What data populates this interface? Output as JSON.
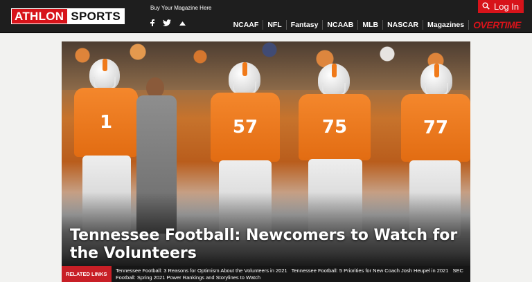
{
  "header": {
    "logo_left": "ATHLON",
    "logo_right": "SPORTS",
    "buy_magazine": "Buy Your Magazine Here",
    "social_icons": [
      "facebook-icon",
      "twitter-icon",
      "chevron-up-icon"
    ],
    "login_label": "Log In",
    "nav": [
      "NCAAF",
      "NFL",
      "Fantasy",
      "NCAAB",
      "MLB",
      "NASCAR",
      "Magazines"
    ],
    "overtime": "OVERTIME"
  },
  "hero": {
    "headline": "Tennessee Football: Newcomers to Watch for the Volunteers",
    "jersey_numbers": [
      "1",
      "57",
      "75",
      "77"
    ]
  },
  "related": {
    "label": "RELATED LINKS",
    "links": [
      "Tennessee Football: 3 Reasons for Optimism About the Volunteers in 2021",
      "Tennessee Football: 5 Priorities for New Coach Josh Heupel in 2021",
      "SEC Football: Spring 2021 Power Rankings and Storylines to Watch"
    ]
  },
  "colors": {
    "brand_red": "#d7131a",
    "header_bg": "#1e1e1e",
    "tennessee_orange": "#f07a1a"
  }
}
